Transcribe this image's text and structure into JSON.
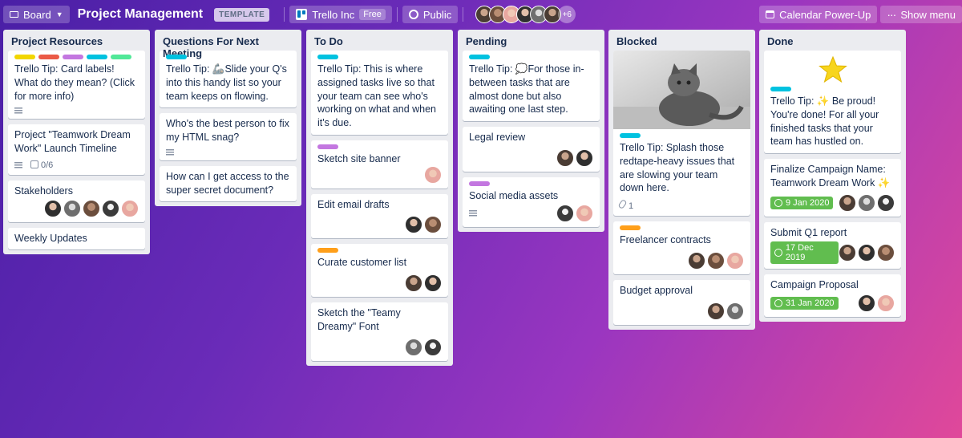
{
  "header": {
    "board_switch": "Board",
    "title": "Project Management",
    "template_badge": "TEMPLATE",
    "team": "Trello Inc",
    "team_plan": "Free",
    "visibility": "Public",
    "more_members": "+6",
    "calendar": "Calendar Power-Up",
    "show_menu": "Show menu"
  },
  "colors": {
    "yellow": "#f2d600",
    "red": "#eb5a46",
    "purple": "#c377e0",
    "sky": "#00c2e0",
    "lime": "#51e898",
    "orange": "#ff9f1a",
    "green": "#61bd4f"
  },
  "lists": [
    {
      "title": "Project Resources",
      "cards": [
        {
          "text": "Trello Tip: Card labels! What do they mean? (Click for more info)"
        },
        {
          "text": "Project \"Teamwork Dream Work\" Launch Timeline",
          "checklist": "0/6"
        },
        {
          "text": "Stakeholders"
        },
        {
          "text": "Weekly Updates"
        }
      ]
    },
    {
      "title": "Questions For Next Meeting",
      "cards": [
        {
          "text": "Trello Tip: 🦾Slide your Q's into this handy list so your team keeps on flowing."
        },
        {
          "text": "Who's the best person to fix my HTML snag?"
        },
        {
          "text": "How can I get access to the super secret document?"
        }
      ]
    },
    {
      "title": "To Do",
      "cards": [
        {
          "text": "Trello Tip: This is where assigned tasks live so that your team can see who's working on what and when it's due."
        },
        {
          "text": "Sketch site banner"
        },
        {
          "text": "Edit email drafts"
        },
        {
          "text": "Curate customer list"
        },
        {
          "text": "Sketch the \"Teamy Dreamy\" Font"
        }
      ]
    },
    {
      "title": "Pending",
      "cards": [
        {
          "text": "Trello Tip: 💭For those in-between tasks that are almost done but also awaiting one last step."
        },
        {
          "text": "Legal review"
        },
        {
          "text": "Social media assets"
        }
      ]
    },
    {
      "title": "Blocked",
      "cards": [
        {
          "text": "Trello Tip: Splash those redtape-heavy issues that are slowing your team down here.",
          "attachments": "1"
        },
        {
          "text": "Freelancer contracts"
        },
        {
          "text": "Budget approval"
        }
      ]
    },
    {
      "title": "Done",
      "cards": [
        {
          "text": "Trello Tip: ✨ Be proud! You're done! For all your finished tasks that your team has hustled on."
        },
        {
          "text": "Finalize Campaign Name: Teamwork Dream Work ✨",
          "due": "9 Jan 2020"
        },
        {
          "text": "Submit Q1 report",
          "due": "17 Dec 2019"
        },
        {
          "text": "Campaign Proposal",
          "due": "31 Jan 2020"
        }
      ]
    }
  ]
}
